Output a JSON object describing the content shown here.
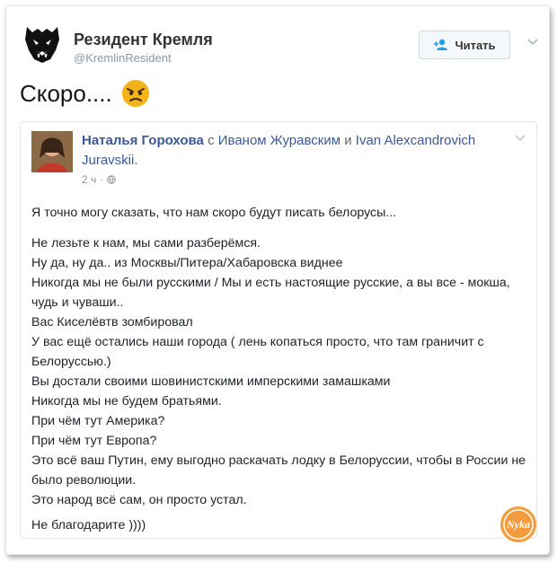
{
  "tweet": {
    "author_name": "Резидент Кремля",
    "author_handle": "@KremlinResident",
    "follow_label": "Читать",
    "text": "Скоро....",
    "emoji": "angry-face"
  },
  "quoted_post": {
    "author": "Наталья Горохова",
    "with_text": "с",
    "tagged_1": "Иваном Журавским",
    "and_text": "и",
    "tagged_2": "Ivan Alexcandrovich Juravskii.",
    "time": "2 ч",
    "privacy_icon": "globe-icon",
    "lines": [
      "Я точно могу сказать, что нам скоро будут писать белорусы...",
      "Не лезьте к нам, мы сами разберёмся.",
      "Ну да, ну да.. из Москвы/Питера/Хабаровска виднее",
      "Никогда мы не были русскими / Мы и есть настоящие русские, а вы все - мокша, чудь и чуваши..",
      "Вас Киселёвтв зомбировал",
      "У вас ещё остались наши города ( лень копаться просто, что там граничит с Белоруссью.)",
      "Вы достали своими шовинистскими имперскими замашками",
      "Никогда мы не будем братьями.",
      "При чём тут Америка?",
      "При чём тут Европа?",
      "Это всё ваш Путин, ему выгодно раскачать лодку в Белоруссии, чтобы в России не было революции.",
      "Это народ всё сам, он просто устал.",
      "Не благодарите ))))"
    ]
  },
  "watermark": {
    "text": "Nyka",
    "color": "#f39c3c"
  }
}
